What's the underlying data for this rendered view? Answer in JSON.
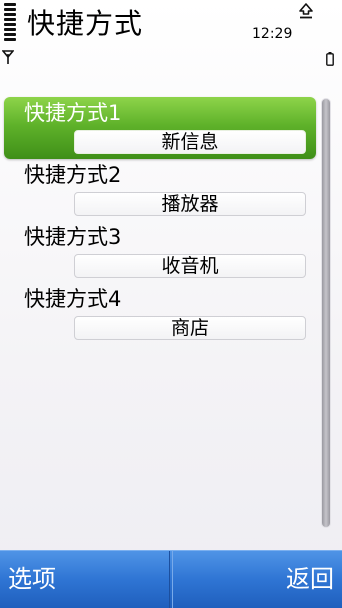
{
  "header": {
    "title": "快捷方式",
    "time": "12:29"
  },
  "status_icons": {
    "signal": "signal-strength-icon",
    "antenna": "antenna-icon",
    "upload": "upload-icon",
    "battery": "battery-icon"
  },
  "shortcuts": [
    {
      "label": "快捷方式1",
      "value": "新信息",
      "selected": true
    },
    {
      "label": "快捷方式2",
      "value": "播放器",
      "selected": false
    },
    {
      "label": "快捷方式3",
      "value": "收音机",
      "selected": false
    },
    {
      "label": "快捷方式4",
      "value": "商店",
      "selected": false
    }
  ],
  "softkeys": {
    "left": "选项",
    "right": "返回"
  },
  "colors": {
    "selection": "#5fb22a",
    "softkey_bar": "#2f75d4"
  }
}
